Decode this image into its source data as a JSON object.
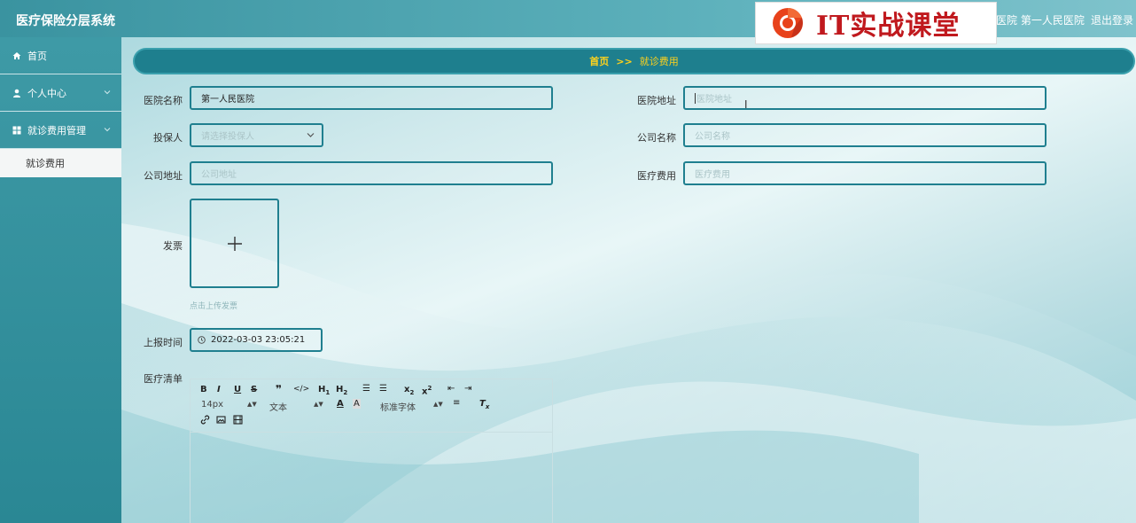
{
  "header": {
    "app_title": "医疗保险分层系统",
    "user_info": "医院 第一人民医院",
    "logout": "退出登录",
    "watermark_text": "IT实战课堂"
  },
  "sidebar": {
    "items": [
      {
        "label": "首页",
        "icon": "home-icon"
      },
      {
        "label": "个人中心",
        "icon": "user-icon"
      },
      {
        "label": "就诊费用管理",
        "icon": "grid-icon"
      }
    ],
    "submenu": [
      {
        "label": "就诊费用"
      }
    ]
  },
  "breadcrumb": {
    "home": "首页",
    "separator": ">>",
    "current": "就诊费用"
  },
  "form": {
    "hospital_name_label": "医院名称",
    "hospital_name_value": "第一人民医院",
    "hospital_address_label": "医院地址",
    "hospital_address_placeholder": "医院地址",
    "insured_label": "投保人",
    "insured_placeholder": "请选择投保人",
    "company_name_label": "公司名称",
    "company_name_placeholder": "公司名称",
    "company_address_label": "公司地址",
    "company_address_placeholder": "公司地址",
    "medical_cost_label": "医疗费用",
    "medical_cost_placeholder": "医疗费用",
    "invoice_label": "发票",
    "invoice_hint": "点击上传发票",
    "report_time_label": "上报时间",
    "report_time_value": "2022-03-03 23:05:21",
    "medical_list_label": "医疗清单"
  },
  "editor": {
    "font_size": "14px",
    "text_style": "文本",
    "font_family": "标准字体"
  },
  "colors": {
    "accent": "#1e7f8e",
    "breadcrumb_text": "#ffd21c",
    "field_border": "#1f7f8f"
  }
}
